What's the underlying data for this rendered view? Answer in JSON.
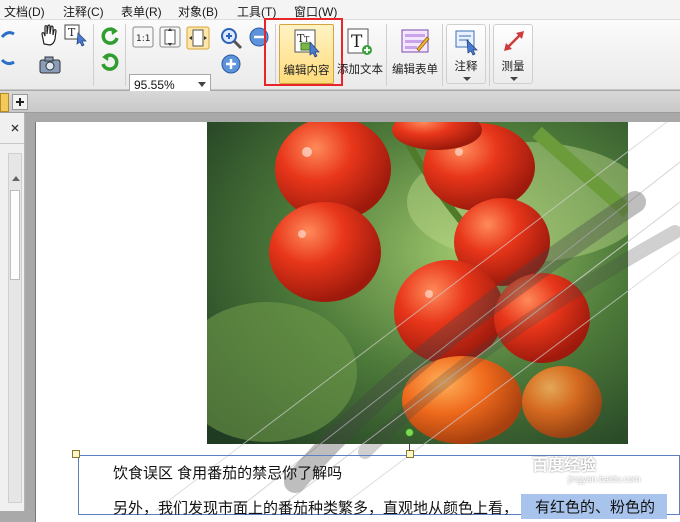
{
  "menu": {
    "items": [
      "文档(D)",
      "注释(C)",
      "表单(R)",
      "对象(B)",
      "工具(T)",
      "窗口(W)"
    ]
  },
  "toolbar": {
    "zoom_value": "95.55%",
    "edit_content_label": "编辑内容",
    "add_text_label": "添加文本",
    "edit_form_label": "编辑表单",
    "annotate_label": "注释",
    "measure_label": "测量",
    "highlight_color": "#e8262a"
  },
  "document": {
    "heading": "饮食误区 食用番茄的禁忌你了解吗",
    "line2_prefix": "另外，我们发现市面上的番茄种类繁多，直观地从颜色上看，",
    "line2_selected": "有红色的、粉色的",
    "watermark": "百度经验",
    "watermark_url": "jingyan.baidu.com"
  }
}
